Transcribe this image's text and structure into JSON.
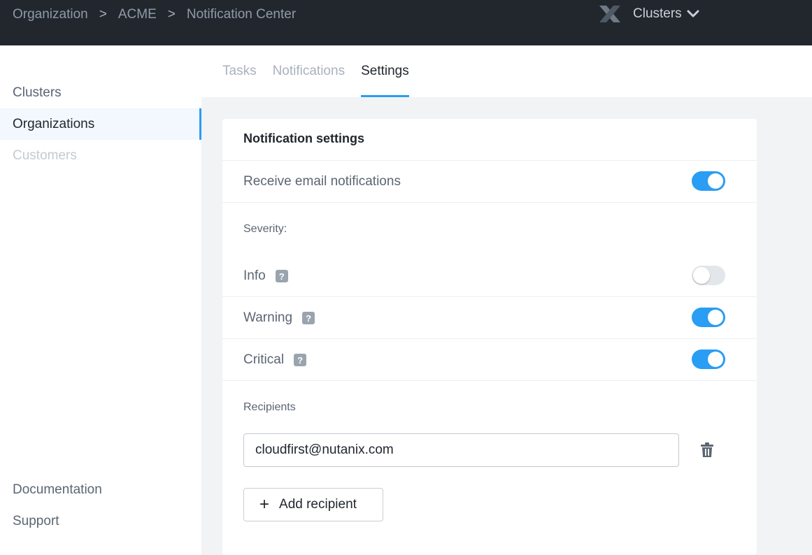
{
  "breadcrumb": {
    "items": [
      "Organization",
      "ACME",
      "Notification Center"
    ],
    "separator": ">"
  },
  "header": {
    "cluster_label": "Clusters"
  },
  "sidebar": {
    "items": [
      {
        "label": "Clusters",
        "state": "normal"
      },
      {
        "label": "Organizations",
        "state": "active"
      },
      {
        "label": "Customers",
        "state": "disabled"
      }
    ],
    "footer": [
      "Documentation",
      "Support"
    ]
  },
  "tabs": [
    {
      "label": "Tasks",
      "active": false
    },
    {
      "label": "Notifications",
      "active": false
    },
    {
      "label": "Settings",
      "active": true
    }
  ],
  "settings": {
    "title": "Notification settings",
    "email_toggle": {
      "label": "Receive email notifications",
      "on": true
    },
    "severity_label": "Severity:",
    "severities": [
      {
        "label": "Info",
        "on": false,
        "help": "?"
      },
      {
        "label": "Warning",
        "on": true,
        "help": "?"
      },
      {
        "label": "Critical",
        "on": true,
        "help": "?"
      }
    ],
    "recipients_label": "Recipients",
    "recipients": [
      "cloudfirst@nutanix.com"
    ],
    "add_recipient_label": "Add recipient",
    "add_icon": "+"
  },
  "colors": {
    "accent": "#2a9df4",
    "topbar": "#22272e",
    "content_bg": "#f2f3f5"
  },
  "icons": [
    "nutanix-logo-icon",
    "chevron-down-icon",
    "help-icon",
    "trash-icon",
    "plus-icon"
  ]
}
